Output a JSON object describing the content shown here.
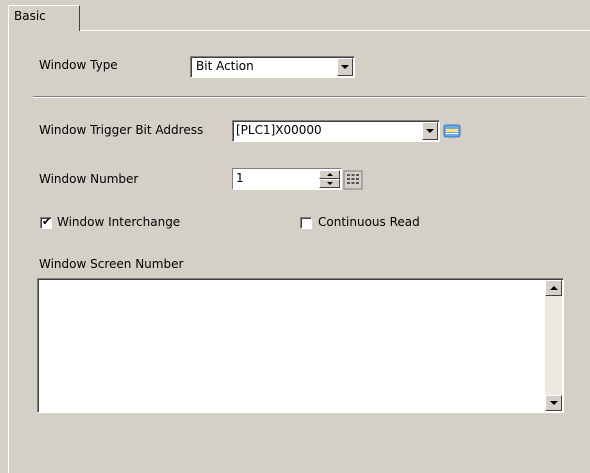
{
  "tabs": [
    {
      "label": "Basic"
    }
  ],
  "window_type": {
    "label": "Window Type",
    "value": "Bit Action"
  },
  "trigger": {
    "label": "Window Trigger Bit Address",
    "value": "[PLC1]X00000",
    "icon": "address-input-icon"
  },
  "window_number": {
    "label": "Window Number",
    "value": "1",
    "icon": "keypad-icon"
  },
  "interchange": {
    "label": "Window Interchange",
    "checked": true
  },
  "continuous_read": {
    "label": "Continuous Read",
    "checked": false
  },
  "screen_number": {
    "label": "Window Screen Number",
    "items": []
  }
}
